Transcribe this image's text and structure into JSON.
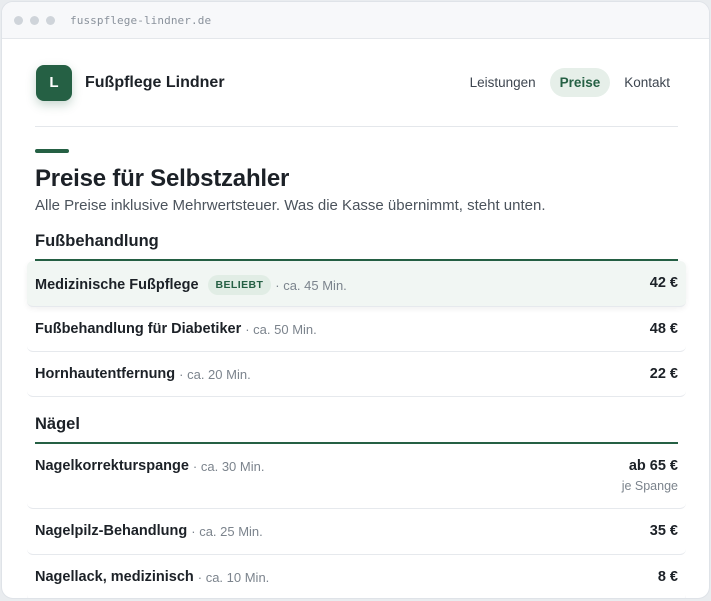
{
  "browser": {
    "url": "fusspflege-lindner.de"
  },
  "header": {
    "logo_letter": "L",
    "brand": "Fußpflege Lindner",
    "nav": [
      {
        "label": "Leistungen",
        "active": false
      },
      {
        "label": "Preise",
        "active": true
      },
      {
        "label": "Kontakt",
        "active": false
      }
    ]
  },
  "page": {
    "title": "Preise für Selbstzahler",
    "subtitle": "Alle Preise inklusive Mehrwertsteuer. Was die Kasse übernimmt, steht unten."
  },
  "sections": [
    {
      "title": "Fußbehandlung",
      "rows": [
        {
          "name": "Medizinische Fußpflege",
          "badge": "BELIEBT",
          "duration": "· ca. 45 Min.",
          "price": "42 €"
        },
        {
          "name": "Fußbehandlung für Diabetiker",
          "duration": "· ca. 50 Min.",
          "price": "48 €"
        },
        {
          "name": "Hornhautentfernung",
          "duration": "· ca. 20 Min.",
          "price": "22 €"
        }
      ]
    },
    {
      "title": "Nägel",
      "rows": [
        {
          "name": "Nagelkorrekturspange",
          "duration": "· ca. 30 Min.",
          "price": "ab 65 €",
          "price_note": "je Spange"
        },
        {
          "name": "Nagelpilz-Behandlung",
          "duration": "· ca. 25 Min.",
          "price": "35 €"
        },
        {
          "name": "Nagellack, medizinisch",
          "duration": "· ca. 10 Min.",
          "price": "8 €"
        }
      ]
    }
  ],
  "colors": {
    "brand": "#256044",
    "badge_bg": "#e1ede5",
    "nav_active_bg": "#e6efe9"
  }
}
